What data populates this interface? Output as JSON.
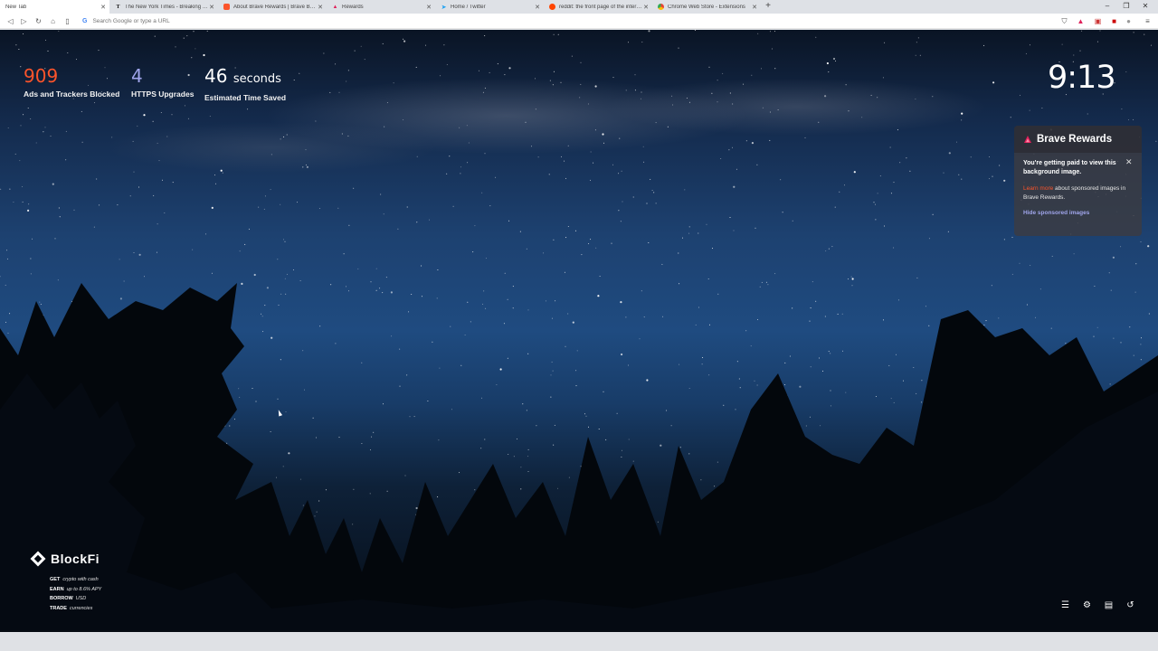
{
  "tabs": [
    {
      "label": "New Tab",
      "icon": "none",
      "active": true
    },
    {
      "label": "The New York Times - Breaking News",
      "icon": "nyt-icon"
    },
    {
      "label": "About Brave Rewards | Brave Browser",
      "icon": "brave-icon"
    },
    {
      "label": "Rewards",
      "icon": "rewards-icon"
    },
    {
      "label": "Home / Twitter",
      "icon": "twitter-icon"
    },
    {
      "label": "reddit: the front page of the internet",
      "icon": "reddit-icon"
    },
    {
      "label": "Chrome Web Store - Extensions",
      "icon": "webstore-icon"
    }
  ],
  "omnibox": {
    "placeholder": "Search Google or type a URL",
    "engine_icon": "G"
  },
  "stats": {
    "ads_blocked": {
      "value": "909",
      "label": "Ads and Trackers Blocked",
      "color": "#fb542b"
    },
    "https_upgrades": {
      "value": "4",
      "label": "HTTPS Upgrades",
      "color": "#a0a5eb"
    },
    "time_saved": {
      "value": "46",
      "unit": "seconds",
      "label": "Estimated Time Saved"
    }
  },
  "clock": "9:13",
  "rewards": {
    "title": "Brave Rewards",
    "message": "You're getting paid to view this background image.",
    "learn_more": "Learn more",
    "learn_more_rest": " about sponsored images in Brave Rewards.",
    "hide_link": "Hide sponsored images"
  },
  "sponsor": {
    "name": "BlockFi",
    "lines": [
      {
        "bold": "GET",
        "rest": "crypto with cash"
      },
      {
        "bold": "EARN",
        "rest": "up to 8.6% APY"
      },
      {
        "bold": "BORROW",
        "rest": "USD"
      },
      {
        "bold": "TRADE",
        "rest": "currencies"
      }
    ]
  },
  "colors": {
    "brave_orange": "#fb542b",
    "link_purple": "#a0a5eb"
  }
}
